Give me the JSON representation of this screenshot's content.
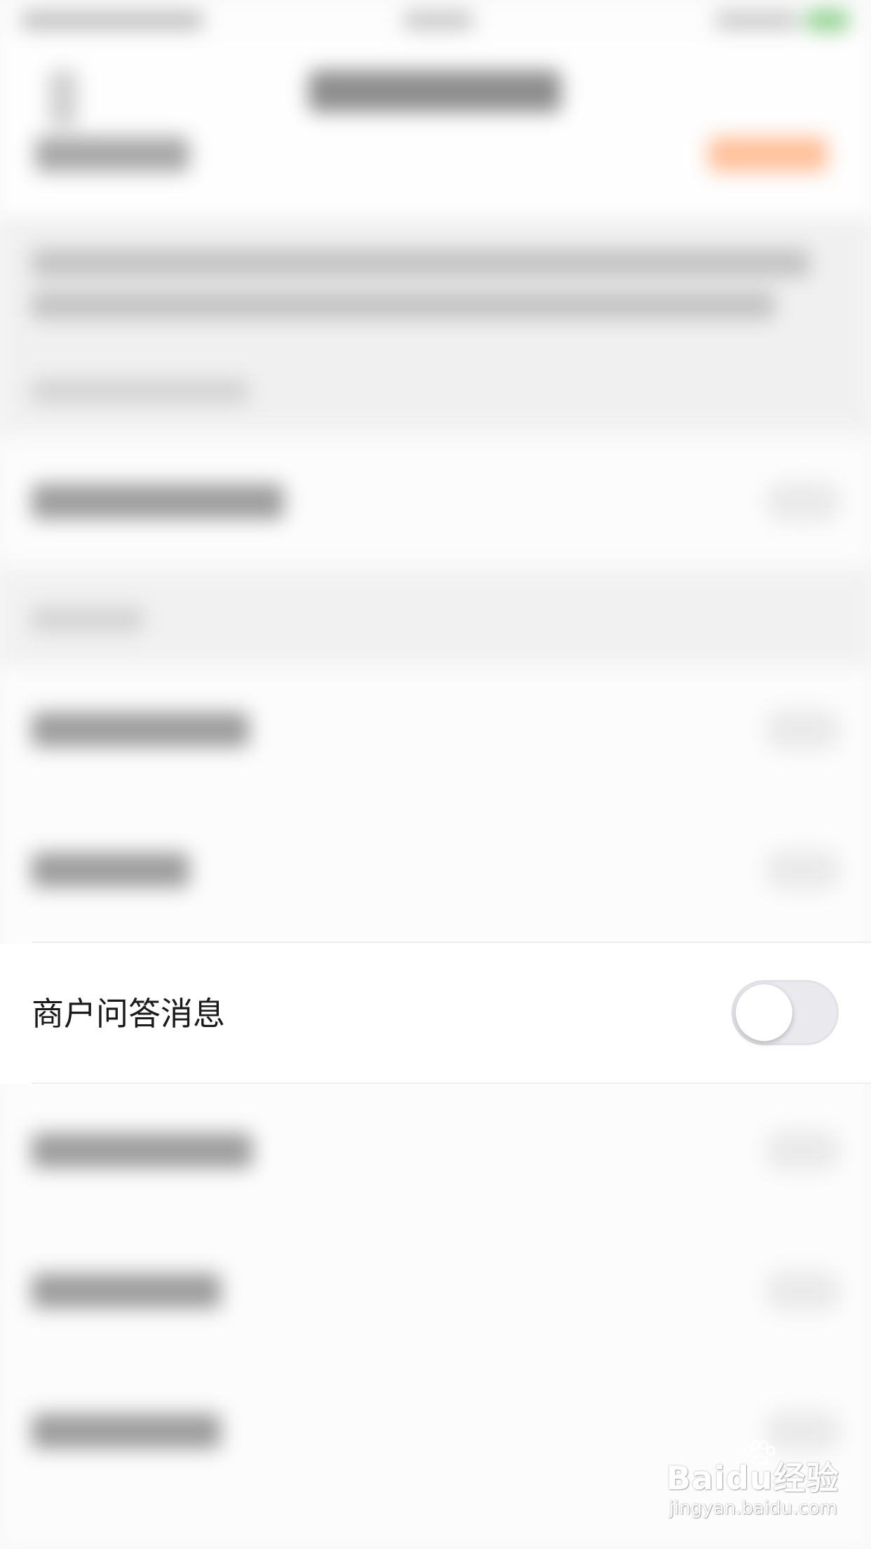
{
  "focused_setting": {
    "label": "商户问答消息",
    "toggle_state": "off",
    "toggle_track_color": "#e9e9ee",
    "knob_color": "#ffffff"
  },
  "accent_colors": {
    "nav_action_button": "#ffc09a",
    "battery": "#8ed08e"
  },
  "watermark": {
    "logo": "Baidu经验",
    "url": "jingyan.baidu.com",
    "icon": "paw-print-icon"
  }
}
